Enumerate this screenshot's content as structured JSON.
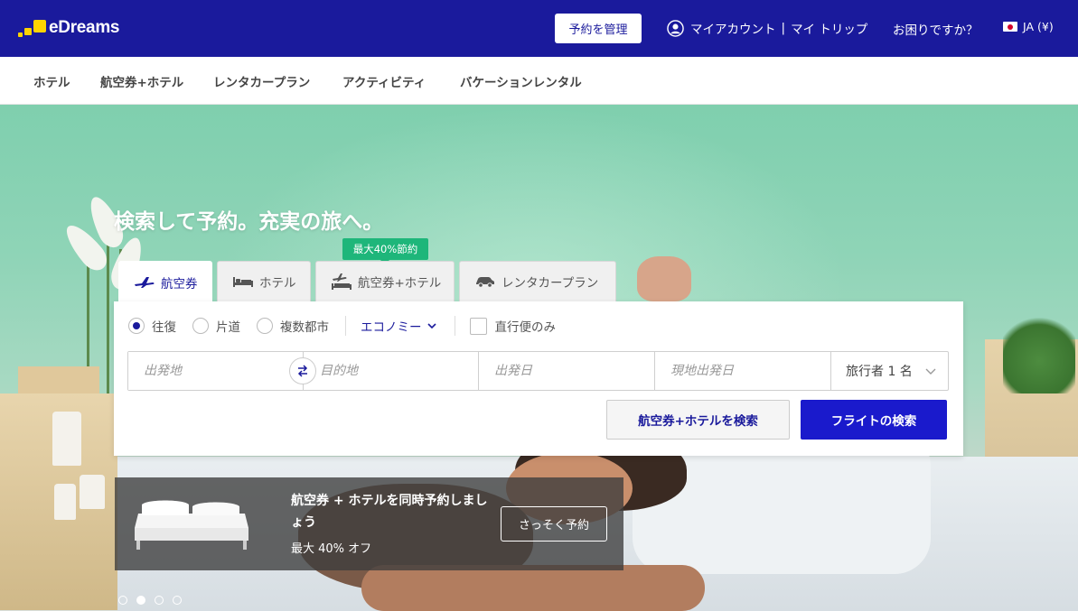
{
  "header": {
    "logo_text": "eDreams",
    "manage_booking": "予約を管理",
    "my_account": "マイアカウント",
    "separator": "|",
    "my_trips": "マイ トリップ",
    "help": "お困りですか？",
    "language": "JA (¥)"
  },
  "subnav": {
    "items": [
      "ホテル",
      "航空券+ホテル",
      "レンタカープラン",
      "アクティビティ",
      "バケーションレンタル"
    ]
  },
  "hero": {
    "title": "検索して予約。充実の旅へ。"
  },
  "tabs": {
    "promo_badge": "最大40%節約",
    "items": [
      "航空券",
      "ホテル",
      "航空券+ホテル",
      "レンタカープラン"
    ]
  },
  "search": {
    "trip_types": [
      "往復",
      "片道",
      "複数都市"
    ],
    "cabin_class": "エコノミー",
    "direct_only": "直行便のみ",
    "origin_placeholder": "出発地",
    "destination_placeholder": "目的地",
    "depart_placeholder": "出発日",
    "return_placeholder": "現地出発日",
    "travelers": "旅行者 1 名",
    "search_package_button": "航空券+ホテルを検索",
    "search_flights_button": "フライトの検索"
  },
  "promo": {
    "title": "航空券 + ホテルを同時予約しましょう",
    "subtitle": "最大 40% オフ",
    "button": "さっそく予約"
  },
  "colors": {
    "brand": "#1a1a9c",
    "primary_button": "#1a1acc",
    "badge_green": "#1eb67a",
    "logo_yellow": "#ffd400"
  }
}
